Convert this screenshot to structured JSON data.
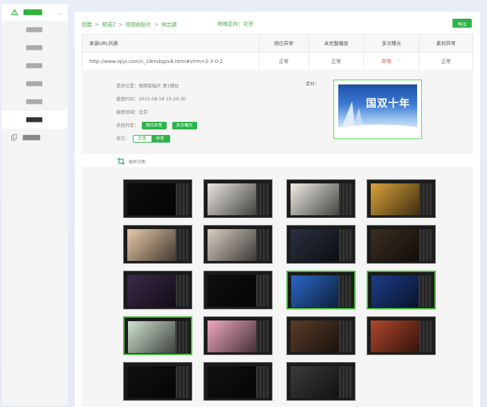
{
  "sidebar": {
    "group1": {
      "label": "█████"
    },
    "subitems": [
      "█████",
      "█████",
      "█████",
      "█████",
      "█████",
      "█████"
    ],
    "group2": {
      "label": "█████"
    }
  },
  "breadcrumb": [
    "优酷",
    "频道2",
    "视频前贴片",
    "林志颖"
  ],
  "breadcrumb_sep": ">",
  "region": "地域定向：北京",
  "export_label": "导出",
  "table": {
    "headers": [
      "来源URL列表",
      "频位异常",
      "未完整播放",
      "多次曝光",
      "素材异常"
    ],
    "row": {
      "url": "http://www.iqiyi.com/v_19rrobgsv8.html#vfrm=2-3-0-2",
      "pos": "正常",
      "incomplete": "正常",
      "multi": "异常",
      "material": "正常"
    }
  },
  "detail": {
    "position_label": "素材位置：",
    "position_value": "视频前贴片 第1频位",
    "time_label": "截图时间：",
    "time_value": "2015.09.18 15:20:30",
    "region_label": "截图地域：",
    "region_value": "北京",
    "judge_label": "系统判定：",
    "judge_tags": [
      "频位异常",
      "多次曝光"
    ],
    "correct_label": "修正：",
    "correct_off": "正常",
    "correct_on": "异常",
    "material_label": "素材：",
    "material_text": "国双十年"
  },
  "shots_label": "截屏详情：",
  "colors": {
    "accent": "#2db34a",
    "danger": "#e84a3c",
    "selected_border": "#47c13c"
  },
  "thumbnails": [
    {
      "row": 0,
      "col": 0,
      "tone": "#0d0d0d",
      "selected": false
    },
    {
      "row": 0,
      "col": 1,
      "tone": "#e9e6e0",
      "selected": false
    },
    {
      "row": 0,
      "col": 2,
      "tone": "#efece4",
      "selected": false
    },
    {
      "row": 0,
      "col": 3,
      "tone": "#d9a23a",
      "selected": false
    },
    {
      "row": 1,
      "col": 0,
      "tone": "#e8c9a8",
      "selected": false
    },
    {
      "row": 1,
      "col": 1,
      "tone": "#d8cfc2",
      "selected": false
    },
    {
      "row": 1,
      "col": 2,
      "tone": "#2a3140",
      "selected": false
    },
    {
      "row": 1,
      "col": 3,
      "tone": "#3a2e22",
      "selected": false
    },
    {
      "row": 2,
      "col": 0,
      "tone": "#3b2a4a",
      "selected": false
    },
    {
      "row": 2,
      "col": 1,
      "tone": "#0f0f0f",
      "selected": false
    },
    {
      "row": 2,
      "col": 2,
      "tone": "#2b67c6",
      "selected": true
    },
    {
      "row": 2,
      "col": 3,
      "tone": "#1d3e8a",
      "selected": true
    },
    {
      "row": 3,
      "col": 0,
      "tone": "#cfe3cf",
      "selected": true
    },
    {
      "row": 3,
      "col": 1,
      "tone": "#f0a8c0",
      "selected": false
    },
    {
      "row": 3,
      "col": 2,
      "tone": "#5a3d2a",
      "selected": false
    },
    {
      "row": 3,
      "col": 3,
      "tone": "#b0462a",
      "selected": false
    },
    {
      "row": 4,
      "col": 0,
      "tone": "#111111",
      "selected": false
    },
    {
      "row": 4,
      "col": 1,
      "tone": "#111111",
      "selected": false
    },
    {
      "row": 4,
      "col": 2,
      "tone": "#3b3b3b",
      "selected": false
    }
  ]
}
